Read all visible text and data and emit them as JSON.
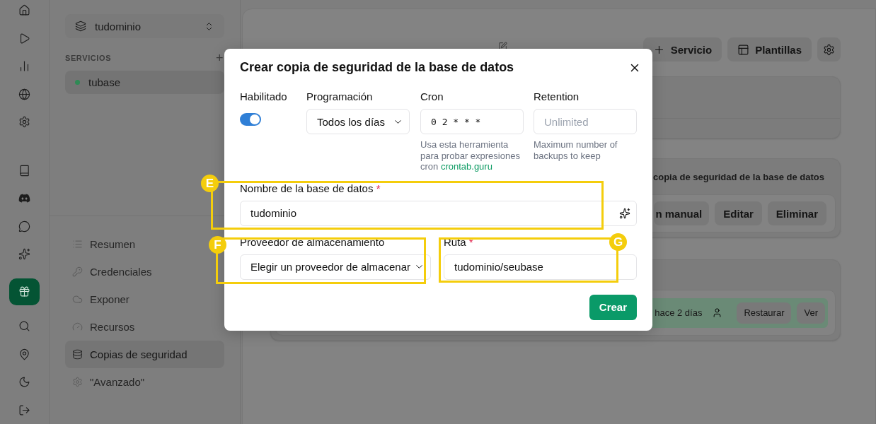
{
  "rail": [
    {
      "selected": false
    },
    {
      "selected": false
    },
    {
      "selected": false
    },
    {
      "selected": false
    },
    {
      "selected": false
    },
    {
      "selected": false
    },
    {
      "selected": false
    },
    {
      "selected": false
    },
    {
      "selected": false
    },
    {
      "selected": true
    },
    {
      "selected": false
    },
    {
      "selected": false
    },
    {
      "selected": false
    },
    {
      "selected": false
    }
  ],
  "sidebar": {
    "project": "tudominio",
    "section_label": "SERVICIOS",
    "add": "+",
    "services": [
      {
        "name": "tubase",
        "color": "#2f8a55",
        "selected": true
      }
    ],
    "nav": [
      {
        "label": "Resumen",
        "selected": false
      },
      {
        "label": "Credenciales",
        "selected": false
      },
      {
        "label": "Exponer",
        "selected": false
      },
      {
        "label": "Recursos",
        "selected": false
      },
      {
        "label": "Copias de seguridad",
        "selected": true
      },
      {
        "label": "\"Avanzado\"",
        "selected": false
      }
    ]
  },
  "main": {
    "actions": [
      "Servicio",
      "Plantillas"
    ],
    "backup_card": {
      "title": "copia de seguridad de la base de datos",
      "buttons": [
        "n manual",
        "Editar",
        "Eliminar"
      ]
    },
    "backups_card": {
      "rows": [
        {
          "time": "hace 2 días",
          "buttons": [
            "Restaurar",
            "Ver"
          ]
        }
      ]
    }
  },
  "dialog": {
    "title": "Crear copia de seguridad de la base de datos",
    "enabled": {
      "label": "Habilitado",
      "on": true
    },
    "schedule": {
      "label": "Programación",
      "value": "Todos los días"
    },
    "cron": {
      "label": "Cron",
      "value": "0 2 * * *",
      "help": "Usa esta herramienta para probar expresiones cron",
      "link": "crontab.guru"
    },
    "retention": {
      "label": "Retention",
      "placeholder": "Unlimited",
      "help": "Maximum number of backups to keep"
    },
    "database": {
      "label": "Nombre de la base de datos",
      "required_mark": "*",
      "value": "tudominio"
    },
    "provider": {
      "label": "Proveedor de almacenamiento",
      "value": "Elegir un proveedor de almacenar"
    },
    "path": {
      "label": "Ruta",
      "required_mark": "*",
      "value": "tudominio/seubase"
    },
    "submit": "Crear"
  },
  "annotations": [
    {
      "letter": "E"
    },
    {
      "letter": "F"
    },
    {
      "letter": "G"
    }
  ]
}
